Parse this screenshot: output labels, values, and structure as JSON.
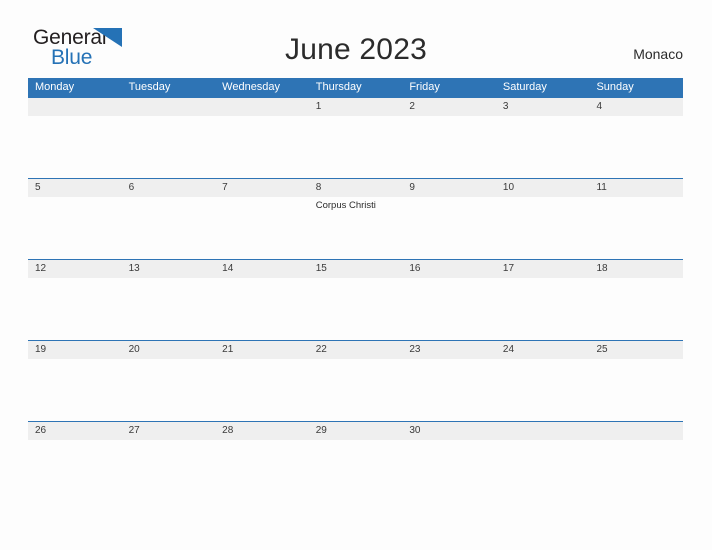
{
  "brand": {
    "name_part1": "General",
    "name_part2": "Blue",
    "flag_icon": "blue-triangle-flag-icon",
    "accent_color": "#2572b6"
  },
  "header": {
    "title": "June 2023",
    "country": "Monaco"
  },
  "colors": {
    "header_blue": "#2e74b5",
    "band_gray": "#efefef",
    "page_background": "#fdfdfd",
    "text": "#2b2b2b"
  },
  "calendar": {
    "month": "June",
    "year": "2023",
    "weekday_headers": [
      "Monday",
      "Tuesday",
      "Wednesday",
      "Thursday",
      "Friday",
      "Saturday",
      "Sunday"
    ],
    "weeks": [
      {
        "days": [
          {
            "num": "",
            "event": ""
          },
          {
            "num": "",
            "event": ""
          },
          {
            "num": "",
            "event": ""
          },
          {
            "num": "1",
            "event": ""
          },
          {
            "num": "2",
            "event": ""
          },
          {
            "num": "3",
            "event": ""
          },
          {
            "num": "4",
            "event": ""
          }
        ]
      },
      {
        "days": [
          {
            "num": "5",
            "event": ""
          },
          {
            "num": "6",
            "event": ""
          },
          {
            "num": "7",
            "event": ""
          },
          {
            "num": "8",
            "event": "Corpus Christi"
          },
          {
            "num": "9",
            "event": ""
          },
          {
            "num": "10",
            "event": ""
          },
          {
            "num": "11",
            "event": ""
          }
        ]
      },
      {
        "days": [
          {
            "num": "12",
            "event": ""
          },
          {
            "num": "13",
            "event": ""
          },
          {
            "num": "14",
            "event": ""
          },
          {
            "num": "15",
            "event": ""
          },
          {
            "num": "16",
            "event": ""
          },
          {
            "num": "17",
            "event": ""
          },
          {
            "num": "18",
            "event": ""
          }
        ]
      },
      {
        "days": [
          {
            "num": "19",
            "event": ""
          },
          {
            "num": "20",
            "event": ""
          },
          {
            "num": "21",
            "event": ""
          },
          {
            "num": "22",
            "event": ""
          },
          {
            "num": "23",
            "event": ""
          },
          {
            "num": "24",
            "event": ""
          },
          {
            "num": "25",
            "event": ""
          }
        ]
      },
      {
        "days": [
          {
            "num": "26",
            "event": ""
          },
          {
            "num": "27",
            "event": ""
          },
          {
            "num": "28",
            "event": ""
          },
          {
            "num": "29",
            "event": ""
          },
          {
            "num": "30",
            "event": ""
          },
          {
            "num": "",
            "event": ""
          },
          {
            "num": "",
            "event": ""
          }
        ]
      }
    ]
  }
}
